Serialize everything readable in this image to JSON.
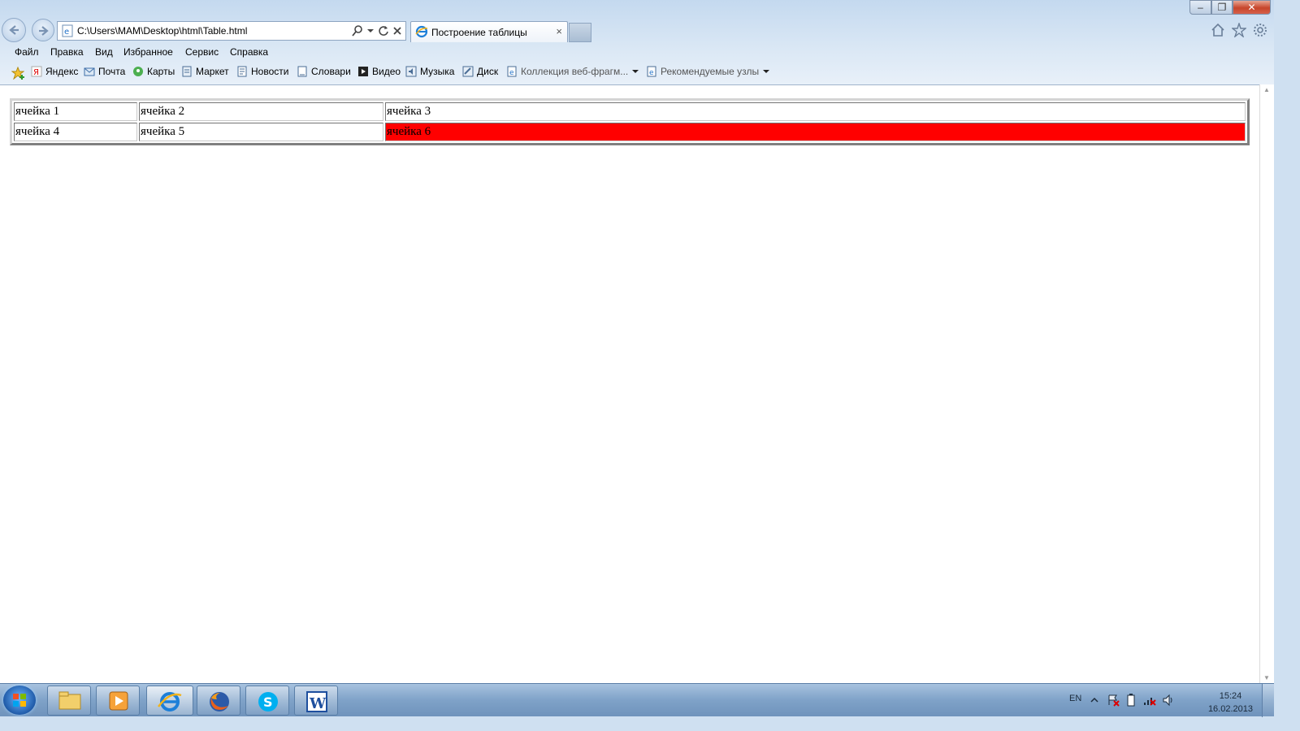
{
  "browser": {
    "address_url": "C:\\Users\\MAM\\Desktop\\html\\Table.html",
    "tab_title": "Построение таблицы",
    "tab_close": "×"
  },
  "menu": {
    "file": "Файл",
    "edit": "Правка",
    "view": "Вид",
    "favorites": "Избранное",
    "tools": "Сервис",
    "help": "Справка"
  },
  "favorites_bar": {
    "items": [
      "Яндекс",
      "Почта",
      "Карты",
      "Маркет",
      "Новости",
      "Словари",
      "Видео",
      "Музыка",
      "Диск",
      "Коллекция веб-фрагм...",
      "Рекомендуемые узлы"
    ]
  },
  "table": {
    "rows": [
      [
        "ячейка 1",
        "ячейка 2",
        "ячейка 3"
      ],
      [
        "ячейка 4",
        "ячейка 5",
        "ячейка 6"
      ]
    ],
    "highlight_color": "#ff0000"
  },
  "taskbar": {
    "language": "EN",
    "time": "15:24",
    "date": "16.02.2013"
  }
}
